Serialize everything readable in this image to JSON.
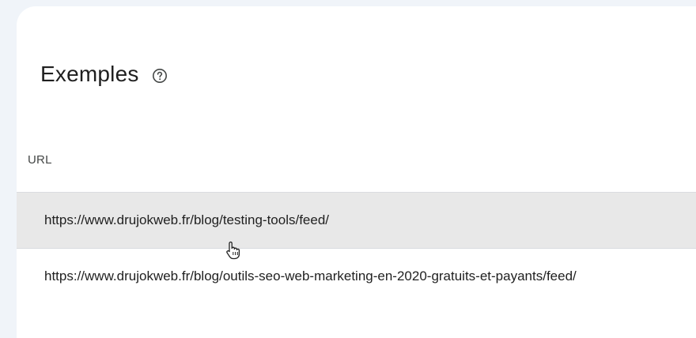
{
  "section": {
    "title": "Exemples",
    "help_icon": "help-circle-icon"
  },
  "table": {
    "column_header": "URL",
    "rows": [
      {
        "url": "https://www.drujokweb.fr/blog/testing-tools/feed/"
      },
      {
        "url": "https://www.drujokweb.fr/blog/outils-seo-web-marketing-en-2020-gratuits-et-payants/feed/"
      }
    ]
  },
  "colors": {
    "page_background": "#f0f4f9",
    "card_background": "#ffffff",
    "hover_row": "#e8e8e8",
    "divider": "#dadce0"
  },
  "cursor_icon": "hand-pointer-icon"
}
